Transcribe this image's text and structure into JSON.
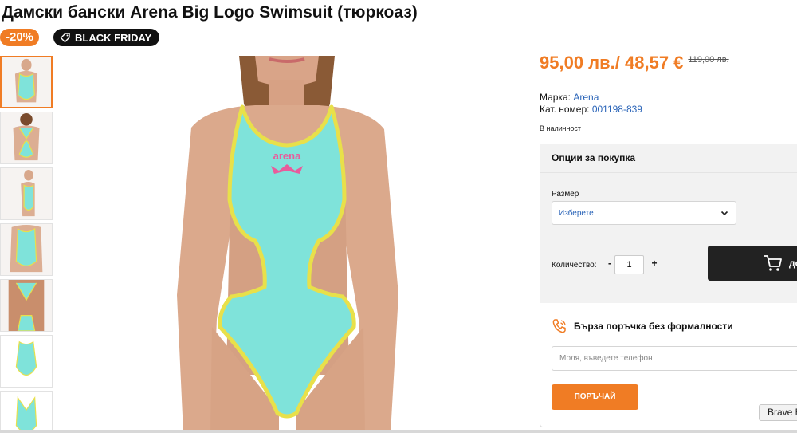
{
  "product": {
    "title": "Дамски бански Arena Big Logo Swimsuit (тюркоаз)",
    "discount_badge": "-20%",
    "promo_badge": "BLACK FRIDAY",
    "price_current": "95,00 лв./ 48,57 €",
    "price_old": "119,00 лв.",
    "brand_label": "Марка:",
    "brand_value": "Arena",
    "sku_label": "Кат. номер:",
    "sku_value": "001198-839",
    "stock_status": "В наличност",
    "thumbnail_count": 7,
    "active_thumbnail": 1
  },
  "purchase": {
    "panel_title": "Опции за покупка",
    "size_label": "Размер",
    "size_selected": "Изберете",
    "qty_label": "Количество:",
    "qty_minus": "-",
    "qty_value": "1",
    "qty_plus": "+",
    "cart_button_partial": "до"
  },
  "quick_order": {
    "title": "Бърза поръчка без формалности",
    "phone_placeholder": "Моля, въведете телефон",
    "submit_label": "ПОРЪЧАЙ"
  },
  "browser": {
    "tooltip": "Brave B"
  },
  "colors": {
    "accent_orange": "#f07c24",
    "link_blue": "#2a64b8",
    "swimsuit_turquoise": "#7fe3da",
    "swimsuit_trim": "#e8e04a",
    "logo_pink": "#e85c9c"
  },
  "icons": [
    "tag-icon",
    "chevron-down-icon",
    "cart-icon",
    "phone-icon"
  ]
}
